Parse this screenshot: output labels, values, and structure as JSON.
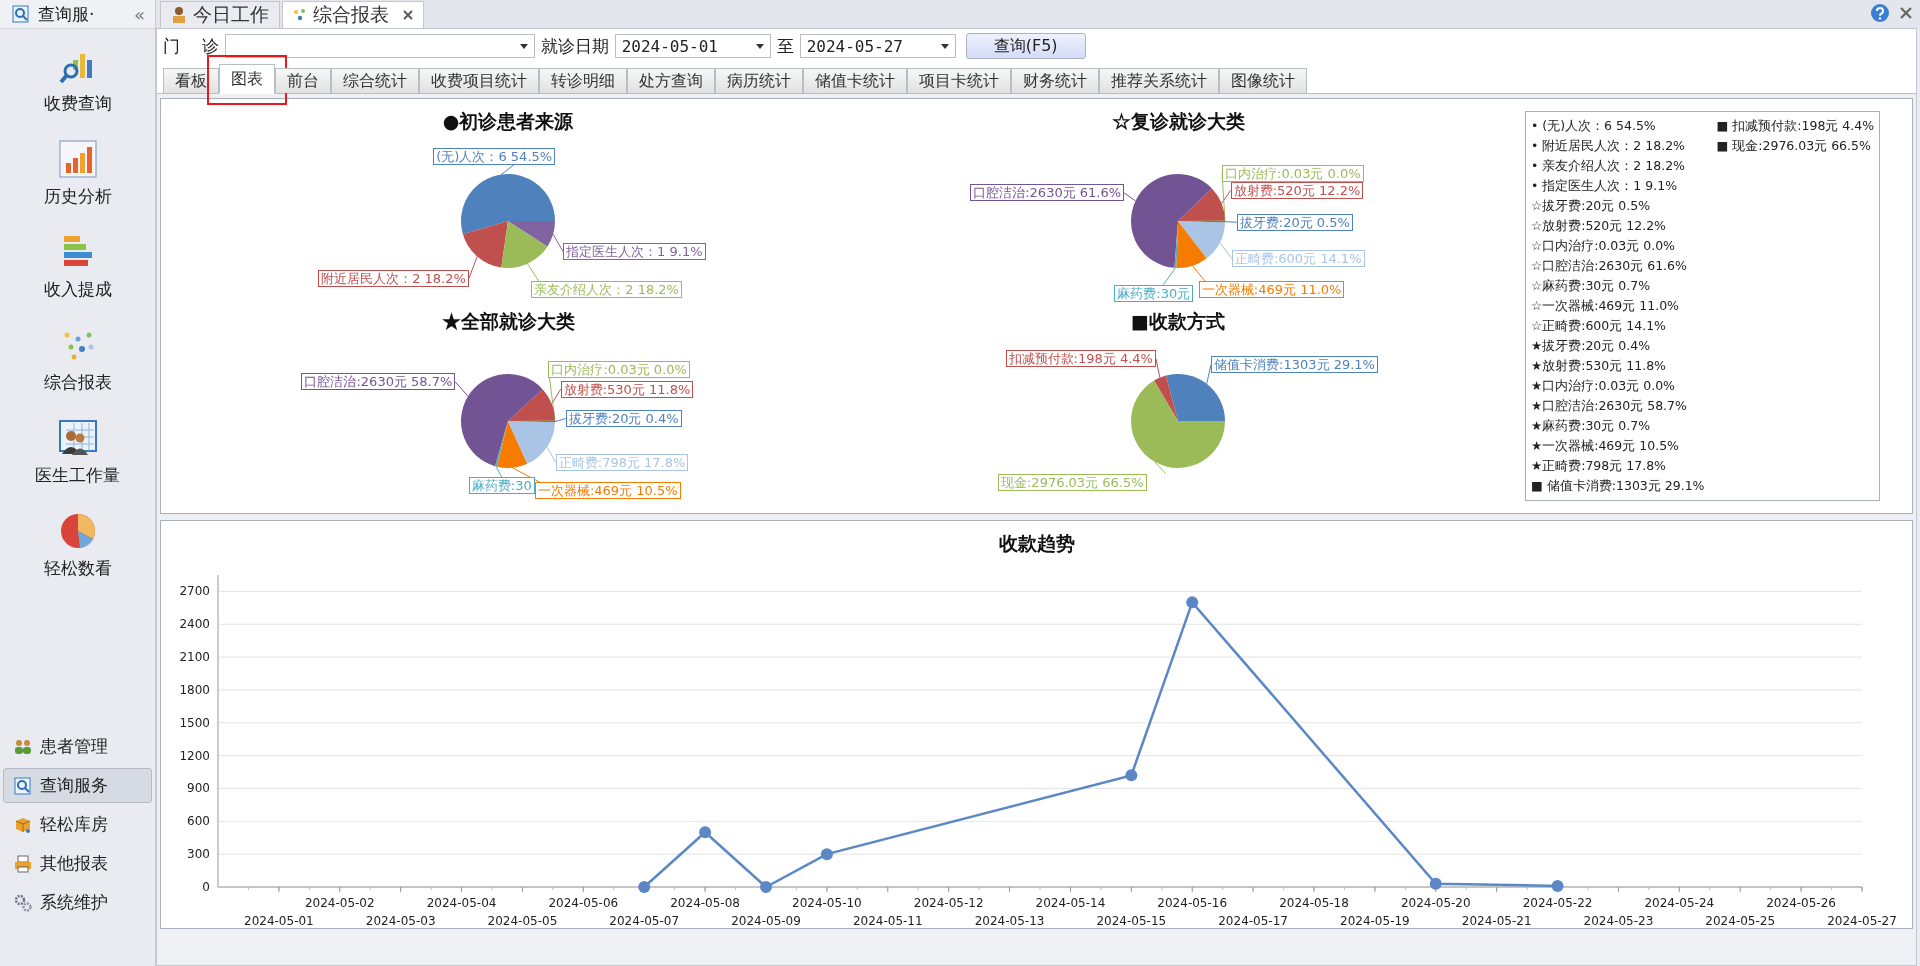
{
  "sidebar": {
    "header": "查询服·",
    "collapse": "«",
    "items": [
      {
        "label": "收费查询"
      },
      {
        "label": "历史分析"
      },
      {
        "label": "收入提成"
      },
      {
        "label": "综合报表"
      },
      {
        "label": "医生工作量"
      },
      {
        "label": "轻松数看"
      }
    ],
    "nav": [
      {
        "label": "患者管理",
        "selected": false
      },
      {
        "label": "查询服务",
        "selected": true
      },
      {
        "label": "轻松库房",
        "selected": false
      },
      {
        "label": "其他报表",
        "selected": false
      },
      {
        "label": "系统维护",
        "selected": false
      }
    ]
  },
  "doc_tabs": [
    {
      "label": "今日工作",
      "selected": false,
      "closable": false
    },
    {
      "label": "综合报表",
      "selected": true,
      "closable": true
    }
  ],
  "filters": {
    "clinic_label": "门    诊",
    "date_label": "就诊日期",
    "date_from": "2024-05-01",
    "to_label": "至",
    "date_to": "2024-05-27",
    "query_button": "查询(F5)"
  },
  "tabs": [
    {
      "label": "看板",
      "selected": false
    },
    {
      "label": "图表",
      "selected": true,
      "highlighted": true
    },
    {
      "label": "前台",
      "selected": false
    },
    {
      "label": "综合统计",
      "selected": false
    },
    {
      "label": "收费项目统计",
      "selected": false
    },
    {
      "label": "转诊明细",
      "selected": false
    },
    {
      "label": "处方查询",
      "selected": false
    },
    {
      "label": "病历统计",
      "selected": false
    },
    {
      "label": "储值卡统计",
      "selected": false
    },
    {
      "label": "项目卡统计",
      "selected": false
    },
    {
      "label": "财务统计",
      "selected": false
    },
    {
      "label": "推荐关系统计",
      "selected": false
    },
    {
      "label": "图像统计",
      "selected": false
    }
  ],
  "pies": [
    {
      "chart_data": {
        "type": "pie",
        "title": "●初诊患者来源",
        "values": [
          6,
          2,
          2,
          1
        ],
        "colors": [
          "#4f81bd",
          "#c0504d",
          "#9bbb59",
          "#8064a2"
        ],
        "value_labels": [
          "(无)人次：6 54.5%",
          "附近居民人次：2 18.2%",
          "亲友介绍人次：2 18.2%",
          "指定医生人次：1 9.1%"
        ]
      }
    },
    {
      "chart_data": {
        "type": "pie",
        "title": "☆复诊就诊大类",
        "values": [
          520,
          2630,
          30,
          469,
          600,
          20,
          0.03
        ],
        "colors": [
          "#c0504d",
          "#725394",
          "#4bacc6",
          "#f57c00",
          "#a9c4e4",
          "#4f81bd",
          "#9bbb59"
        ],
        "value_labels": [
          "放射费:520元 12.2%",
          "口腔洁治:2630元 61.6%",
          "麻药费:30元",
          "一次器械:469元 11.0%",
          "正畸费:600元 14.1%",
          "拔牙费:20元 0.5%",
          "口内治疗:0.03元 0.0%"
        ]
      }
    },
    {
      "chart_data": {
        "type": "pie",
        "title": "★全部就诊大类",
        "values": [
          530,
          2630,
          30,
          469,
          798,
          20,
          0.03
        ],
        "colors": [
          "#c0504d",
          "#725394",
          "#4bacc6",
          "#f57c00",
          "#a9c4e4",
          "#4f81bd",
          "#9bbb59"
        ],
        "value_labels": [
          "放射费:530元 11.8%",
          "口腔洁治:2630元 58.7%",
          "麻药费:30",
          "一次器械:469元 10.5%",
          "正畸费:798元 17.8%",
          "拔牙费:20元 0.4%",
          "口内治疗:0.03元 0.0%"
        ]
      }
    },
    {
      "chart_data": {
        "type": "pie",
        "title": "■收款方式",
        "values": [
          1303,
          198,
          2976.03
        ],
        "colors": [
          "#4f81bd",
          "#c0504d",
          "#9bbb59"
        ],
        "value_labels": [
          "储值卡消费:1303元 29.1%",
          "扣减预付款:198元 4.4%",
          "现金:2976.03元 66.5%"
        ]
      }
    }
  ],
  "legend": [
    "• (无)人次：6 54.5%",
    "• 附近居民人次：2 18.2%",
    "• 亲友介绍人次：2 18.2%",
    "• 指定医生人次：1 9.1%",
    "☆拔牙费:20元 0.5%",
    "☆放射费:520元 12.2%",
    "☆口内治疗:0.03元 0.0%",
    "☆口腔洁治:2630元 61.6%",
    "☆麻药费:30元 0.7%",
    "☆一次器械:469元 11.0%",
    "☆正畸费:600元 14.1%",
    "★拔牙费:20元 0.4%",
    "★放射费:530元 11.8%",
    "★口内治疗:0.03元 0.0%",
    "★口腔洁治:2630元 58.7%",
    "★麻药费:30元 0.7%",
    "★一次器械:469元 10.5%",
    "★正畸费:798元 17.8%",
    "■ 储值卡消费:1303元 29.1%",
    "■ 扣减预付款:198元 4.4%",
    "■ 现金:2976.03元 66.5%"
  ],
  "trend": {
    "chart_data": {
      "type": "line",
      "title": "收款趋势",
      "x": [
        "2024-05-07",
        "2024-05-08",
        "2024-05-09",
        "2024-05-10",
        "2024-05-15",
        "2024-05-16",
        "2024-05-20",
        "2024-05-22"
      ],
      "series": [
        {
          "color": "#5b87c5",
          "marker": "circle",
          "values": [
            0,
            500,
            0,
            300,
            1020,
            2600,
            30,
            10
          ]
        }
      ],
      "grid": true,
      "xlim": [
        "2024-04-30",
        "2024-05-27"
      ],
      "ylim": [
        0,
        2850
      ],
      "yticks": [
        0,
        300,
        600,
        900,
        1200,
        1500,
        1800,
        2100,
        2400,
        2700
      ],
      "xticks": [
        "2024-05-01",
        "2024-05-03",
        "2024-05-05",
        "2024-05-07",
        "2024-05-09",
        "2024-05-11",
        "2024-05-13",
        "2024-05-15",
        "2024-05-17",
        "2024-05-19",
        "2024-05-21",
        "2024-05-23",
        "2024-05-25",
        "2024-05-27"
      ],
      "annotations": [
        "2024-05-02",
        "2024-05-04",
        "2024-05-06",
        "2024-05-08",
        "2024-05-10",
        "2024-05-12",
        "2024-05-14",
        "2024-05-16",
        "2024-05-18",
        "2024-05-20",
        "2024-05-22",
        "2024-05-24",
        "2024-05-26"
      ]
    }
  }
}
